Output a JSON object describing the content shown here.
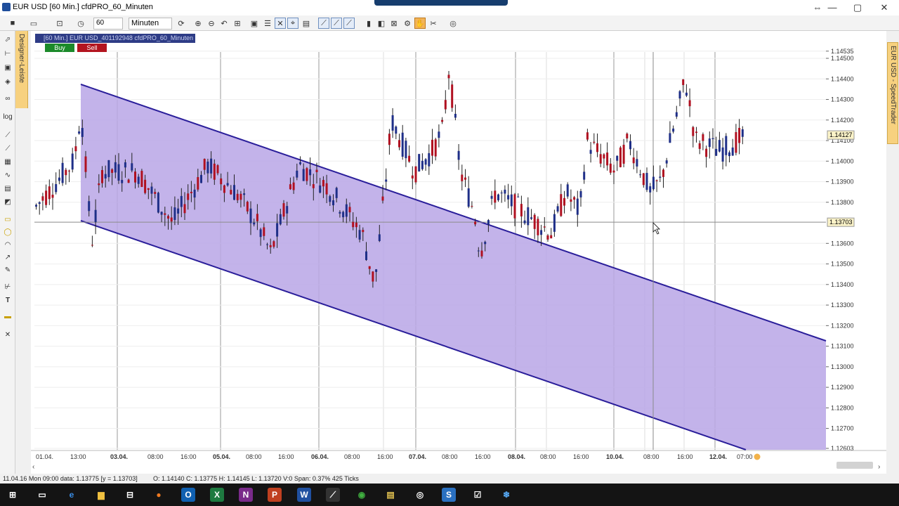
{
  "window": {
    "title": "EUR USD [60 Min.]   cfdPRO_60_Minuten",
    "controls": [
      "⇔",
      "—",
      "▢",
      "✕"
    ]
  },
  "toolbar": {
    "period_value": "60",
    "unit_value": "Minuten"
  },
  "designer_bar": {
    "label": "Designer-Leiste"
  },
  "speedtrader_bar": {
    "label": "EUR USD - SpeedTrader"
  },
  "chart": {
    "header_label": "[60 Min.] EUR USD_401192948 cfdPRO_60_Minuten",
    "buy_label": "Buy",
    "sell_label": "Sell",
    "price_labels": [
      "1.14535",
      "1.14500",
      "1.14400",
      "1.14300",
      "1.14200",
      "1.14100",
      "1.14000",
      "1.13900",
      "1.13800",
      "1.13600",
      "1.13500",
      "1.13400",
      "1.13300",
      "1.13200",
      "1.13100",
      "1.13000",
      "1.12900",
      "1.12800",
      "1.12700",
      "1.12603"
    ],
    "current_price_tag": "1.14127",
    "crosshair_price_tag": "1.13703",
    "time_labels": [
      {
        "t": "01.04.",
        "bold": false
      },
      {
        "t": "13:00",
        "bold": false
      },
      {
        "t": "03.04.",
        "bold": true
      },
      {
        "t": "08:00",
        "bold": false
      },
      {
        "t": "16:00",
        "bold": false
      },
      {
        "t": "05.04.",
        "bold": true
      },
      {
        "t": "08:00",
        "bold": false
      },
      {
        "t": "16:00",
        "bold": false
      },
      {
        "t": "06.04.",
        "bold": true
      },
      {
        "t": "08:00",
        "bold": false
      },
      {
        "t": "16:00",
        "bold": false
      },
      {
        "t": "07.04.",
        "bold": true
      },
      {
        "t": "08:00",
        "bold": false
      },
      {
        "t": "16:00",
        "bold": false
      },
      {
        "t": "08.04.",
        "bold": true
      },
      {
        "t": "08:00",
        "bold": false
      },
      {
        "t": "16:00",
        "bold": false
      },
      {
        "t": "10.04.",
        "bold": true
      },
      {
        "t": "08:00",
        "bold": false
      },
      {
        "t": "16:00",
        "bold": false
      },
      {
        "t": "12.04.",
        "bold": true
      },
      {
        "t": "07:00",
        "bold": false
      }
    ],
    "colors": {
      "up": "#1f2f88",
      "down": "#b01020",
      "channel_fill": "#b9a6e6",
      "channel_line": "#2a1e9a"
    }
  },
  "status": {
    "left_text": "11.04.16 Mon  09:00 data: 1.13775 [y = 1.13703]",
    "right_text": "O: 1.14140 C: 1.13775 H: 1.14145 L: 1.13720 V:0 Span: 0.37% 425 Ticks"
  },
  "taskbar": {
    "icons": [
      "windows-start-icon",
      "task-view-icon",
      "edge-icon",
      "file-explorer-icon",
      "store-icon",
      "firefox-icon",
      "outlook-icon",
      "excel-icon",
      "onenote-icon",
      "powerpoint-icon",
      "word-icon",
      "trading-app-icon",
      "chrome-icon",
      "files-icon",
      "app-circle-icon",
      "skype-icon",
      "tasks-icon",
      "snowflake-icon"
    ]
  }
}
